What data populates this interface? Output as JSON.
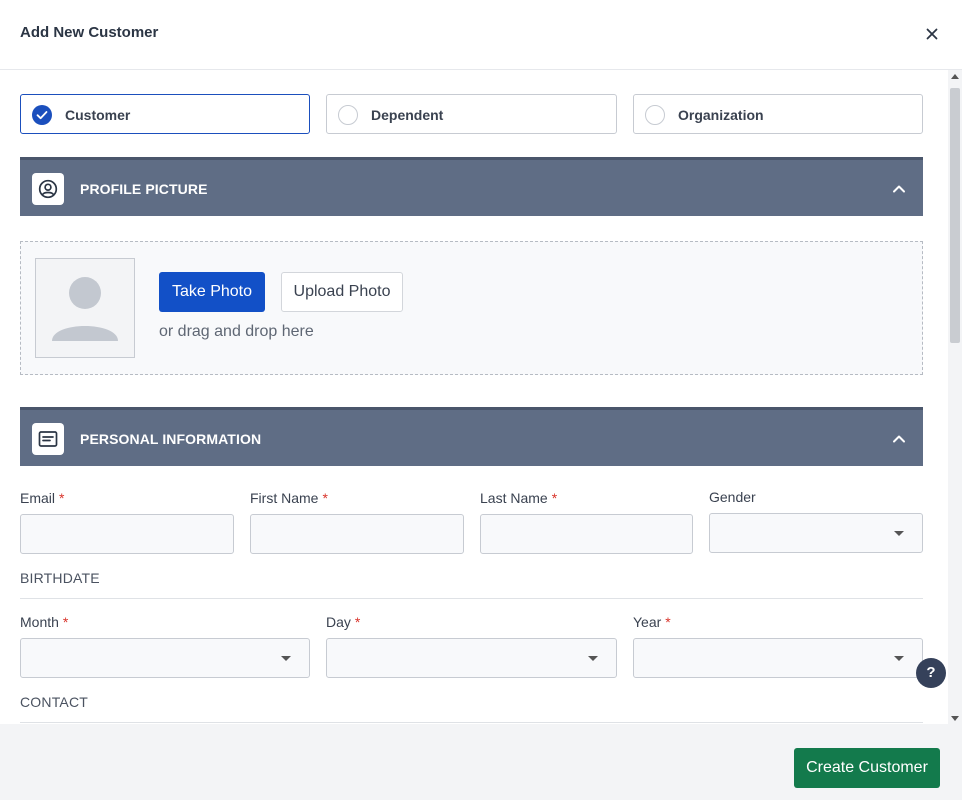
{
  "modal": {
    "title": "Add New Customer",
    "close_icon": "close-icon"
  },
  "customer_types": [
    {
      "label": "Customer",
      "selected": true
    },
    {
      "label": "Dependent",
      "selected": false
    },
    {
      "label": "Organization",
      "selected": false
    }
  ],
  "profile_picture": {
    "title": "PROFILE PICTURE",
    "icon": "user-circle-icon",
    "take_photo_label": "Take Photo",
    "upload_photo_label": "Upload Photo",
    "drop_hint": "or drag and drop here"
  },
  "personal_info": {
    "title": "PERSONAL INFORMATION",
    "icon": "id-card-icon",
    "fields": {
      "email": {
        "label": "Email",
        "required": "*",
        "value": ""
      },
      "first_name": {
        "label": "First Name",
        "required": "*",
        "value": ""
      },
      "last_name": {
        "label": "Last Name",
        "required": "*",
        "value": ""
      },
      "gender": {
        "label": "Gender",
        "value": ""
      }
    },
    "birthdate": {
      "group_label": "BIRTHDATE",
      "month": {
        "label": "Month",
        "required": "*",
        "value": ""
      },
      "day": {
        "label": "Day",
        "required": "*",
        "value": ""
      },
      "year": {
        "label": "Year",
        "required": "*",
        "value": ""
      }
    },
    "contact": {
      "group_label": "CONTACT"
    }
  },
  "help_label": "?",
  "footer": {
    "create_label": "Create Customer"
  },
  "colors": {
    "primary": "#1250c7",
    "section_header": "#5f6d85",
    "create_button": "#137a4c",
    "required": "#d9342b"
  }
}
